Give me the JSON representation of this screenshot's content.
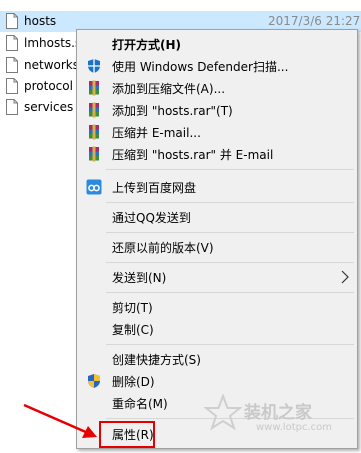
{
  "files": [
    {
      "name": "hosts",
      "date": "2017/3/6 21:27",
      "selected": true
    },
    {
      "name": "lmhosts.s",
      "date": "",
      "selected": false
    },
    {
      "name": "networks",
      "date": "",
      "selected": false
    },
    {
      "name": "protocol",
      "date": "",
      "selected": false
    },
    {
      "name": "services",
      "date": "",
      "selected": false
    }
  ],
  "menu": {
    "open_with": "打开方式(H)",
    "defender_scan": "使用 Windows Defender扫描...",
    "add_to_archive": "添加到压缩文件(A)...",
    "add_to_hosts_rar": "添加到 \"hosts.rar\"(T)",
    "compress_email": "压缩并 E-mail...",
    "compress_hosts_email": "压缩到 \"hosts.rar\" 并 E-mail",
    "upload_baidu": "上传到百度网盘",
    "send_qq": "通过QQ发送到",
    "restore_version": "还原以前的版本(V)",
    "send_to": "发送到(N)",
    "cut": "剪切(T)",
    "copy": "复制(C)",
    "create_shortcut": "创建快捷方式(S)",
    "delete": "删除(D)",
    "rename": "重命名(M)",
    "properties": "属性(R)"
  },
  "watermark": {
    "title": "装机之家",
    "url": "www.lotpc.com"
  },
  "colors": {
    "selection": "#cce8ff",
    "menu_bg": "#f0f0f0",
    "annotation_red": "#e60000"
  }
}
